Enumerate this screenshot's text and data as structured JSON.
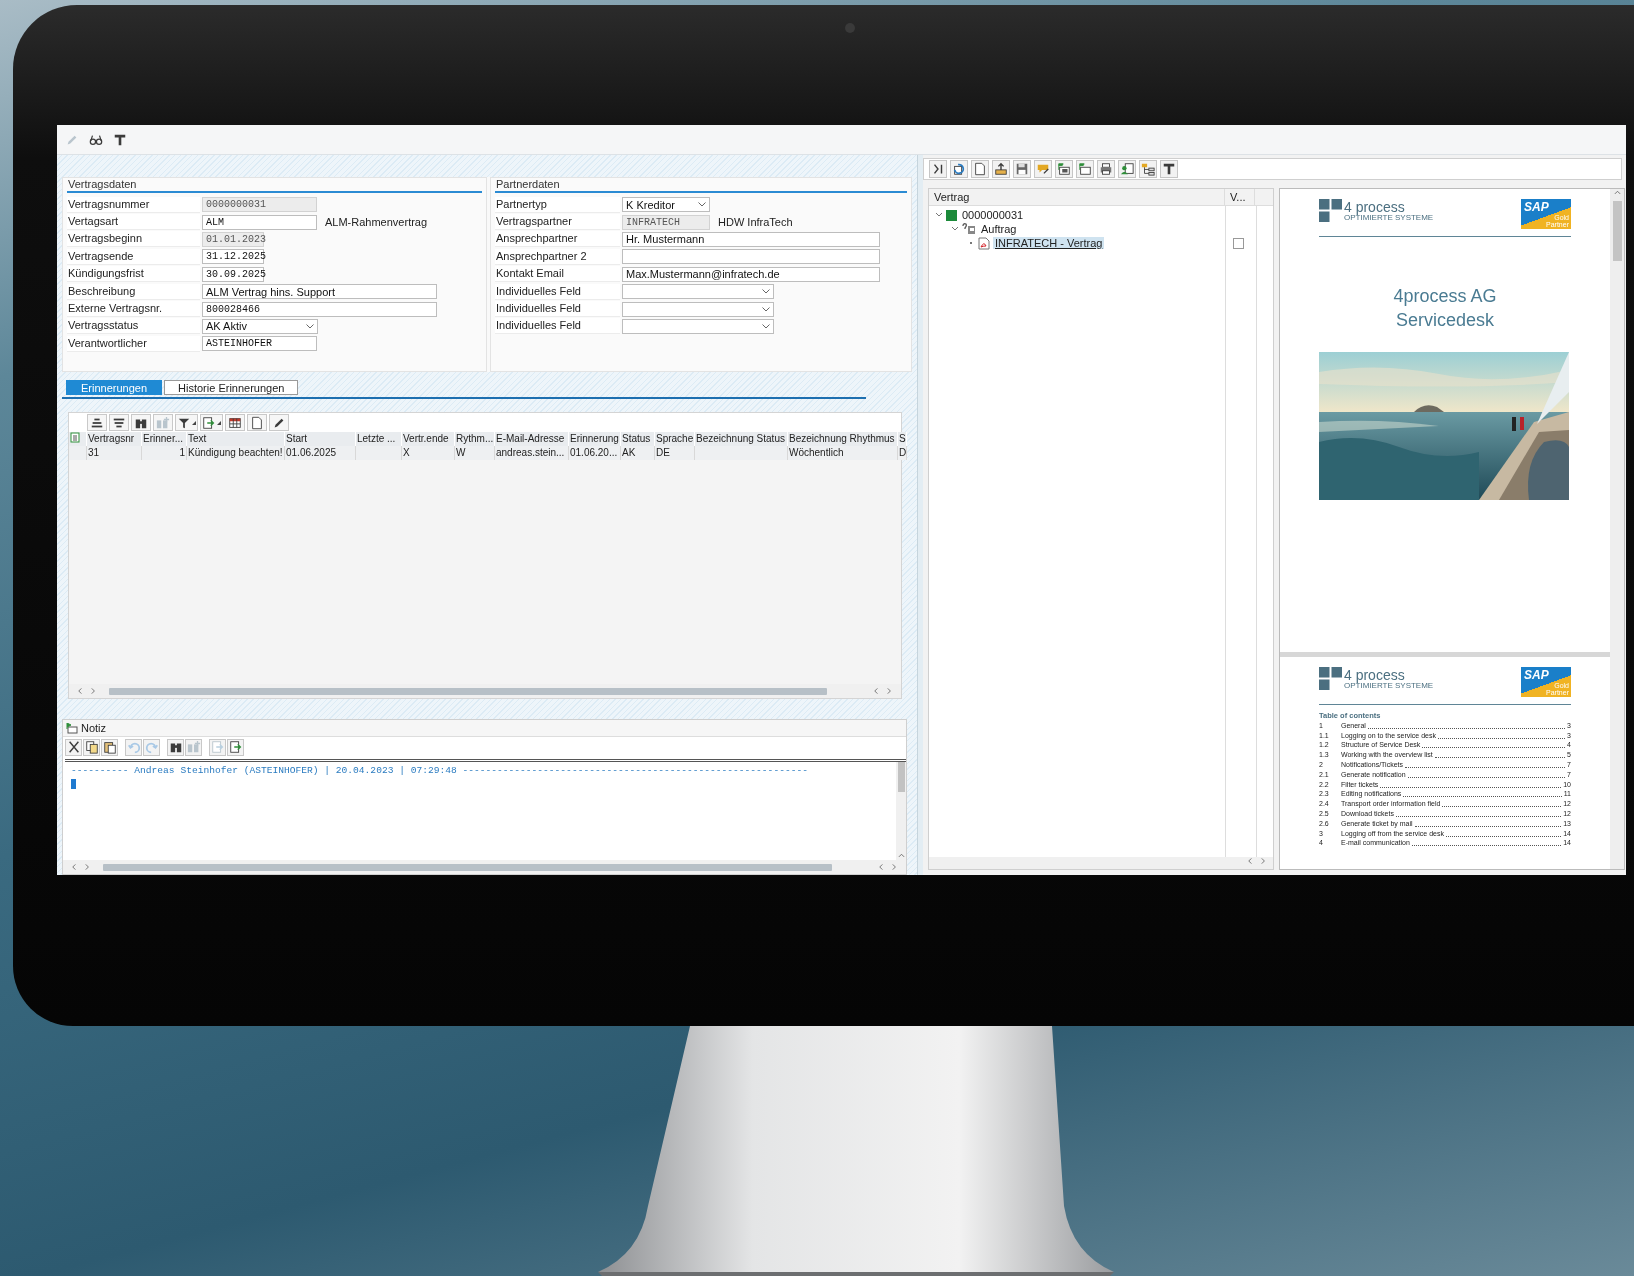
{
  "top_toolbar": [
    {
      "kind": "edit",
      "disabled": true
    },
    {
      "kind": "display",
      "disabled": false
    },
    {
      "kind": "layout",
      "disabled": false
    }
  ],
  "groups": [
    {
      "title": "Vertragsdaten",
      "fields": [
        {
          "label": "Vertragsnummer",
          "value": "0000000031",
          "kind": "code",
          "readonly": true
        },
        {
          "label": "Vertagsart",
          "value": "ALM",
          "kind": "code",
          "readonly": false,
          "note": "ALM-Rahmenvertrag"
        },
        {
          "label": "Vertragsbeginn",
          "value": "01.01.2023",
          "kind": "date",
          "readonly": true
        },
        {
          "label": "Vertragsende",
          "value": "31.12.2025",
          "kind": "date",
          "readonly": false
        },
        {
          "label": "Kündigungsfrist",
          "value": "30.09.2025",
          "kind": "date",
          "readonly": false
        },
        {
          "label": "Beschreibung",
          "value": "ALM Vertrag hins. Support",
          "kind": "long_text",
          "readonly": false
        },
        {
          "label": "Externe Vertragsnr.",
          "value": "800028466",
          "kind": "long_code",
          "readonly": false
        },
        {
          "label": "Vertragsstatus",
          "value": "AK Aktiv",
          "kind": "select",
          "readonly": false
        },
        {
          "label": "Verantwortlicher",
          "value": "ASTEINHOFER",
          "kind": "code",
          "readonly": false
        }
      ]
    },
    {
      "title": "Partnerdaten",
      "fields": [
        {
          "label": "Partnertyp",
          "value": "K Kreditor",
          "kind": "select",
          "readonly": false
        },
        {
          "label": "Vertragspartner",
          "value": "INFRATECH",
          "kind": "code",
          "readonly": true,
          "note": "HDW InfraTech"
        },
        {
          "label": "Ansprechpartner",
          "value": "Hr. Mustermann",
          "kind": "long_text",
          "readonly": false
        },
        {
          "label": "Ansprechpartner 2",
          "kind": "long_text",
          "readonly": false
        },
        {
          "label": "Kontakt Email",
          "value": "Max.Mustermann@infratech.de",
          "kind": "long_text",
          "readonly": false
        },
        {
          "label": "Individuelles Feld",
          "kind": "long_select",
          "readonly": false
        },
        {
          "label": "Individuelles Feld",
          "kind": "long_select",
          "readonly": false
        },
        {
          "label": "Individuelles Feld",
          "kind": "long_select",
          "readonly": false
        }
      ]
    }
  ],
  "tabs": [
    {
      "label": "Erinnerungen",
      "selected": true
    },
    {
      "label": "Historie Erinnerungen",
      "selected": false
    }
  ],
  "table_toolbar": [
    {
      "kind": "sort_asc",
      "disabled": false
    },
    {
      "kind": "sort_desc",
      "disabled": false
    },
    {
      "kind": "find",
      "disabled": false
    },
    {
      "kind": "find_next",
      "disabled": true
    },
    {
      "kind": "filter",
      "disabled": false
    },
    {
      "kind": "export",
      "disabled": false
    },
    {
      "kind": "grid",
      "disabled": false
    },
    {
      "kind": "new",
      "disabled": false
    },
    {
      "kind": "pencil",
      "disabled": false
    }
  ],
  "table": {
    "columns": [
      "Vertragsnr",
      "Erinner...",
      "Text",
      "Start",
      "Letzte ...",
      "Vertr.ende",
      "Rythm...",
      "E-Mail-Adresse",
      "Erinnerung",
      "Status",
      "Sprache",
      "Bezeichnung Status",
      "Bezeichnung Rhythmus",
      "S"
    ],
    "rows": [
      {
        "cells": [
          "31",
          "1",
          "Kündigung beachten!",
          "01.06.2025",
          null,
          "X",
          "W",
          "andreas.stein...",
          "01.06.20...",
          "AK",
          "DE",
          null,
          "Wöchentlich",
          "D"
        ]
      }
    ]
  },
  "note": {
    "title": "Notiz",
    "toolbar": [
      {
        "kind": "cut",
        "disabled": false
      },
      {
        "kind": "copy",
        "disabled": false
      },
      {
        "kind": "paste",
        "disabled": false
      },
      {
        "kind": "undo",
        "disabled": true
      },
      {
        "kind": "redo",
        "disabled": true
      },
      {
        "kind": "find",
        "disabled": false
      },
      {
        "kind": "find_next",
        "disabled": true
      },
      {
        "kind": "import",
        "disabled": true
      },
      {
        "kind": "export",
        "disabled": false
      }
    ],
    "text": "---------- Andreas Steinhofer (ASTEINHOFER) | 20.04.2023 | 07:29:48 ------------------------------------------------------------"
  },
  "right_toolbar": [
    {
      "kind": "collapse"
    },
    {
      "kind": "refresh"
    },
    {
      "kind": "new"
    },
    {
      "kind": "upload"
    },
    {
      "kind": "save"
    },
    {
      "kind": "comment"
    },
    {
      "kind": "tree_down"
    },
    {
      "kind": "tree_up"
    },
    {
      "kind": "print"
    },
    {
      "kind": "user"
    },
    {
      "kind": "hierarchy"
    },
    {
      "kind": "layout"
    }
  ],
  "tree": {
    "columns": [
      "Vertrag",
      "V..."
    ],
    "nodes": [
      {
        "label": "0000000031",
        "kind": "contract",
        "expanded": true,
        "selected": false,
        "children": [
          {
            "label": "Auftrag",
            "kind": "folder",
            "expanded": true,
            "selected": false,
            "children": [
              {
                "label": "INFRATECH - Vertrag",
                "kind": "pdf",
                "selected": true,
                "checked": false
              }
            ]
          }
        ]
      }
    ]
  },
  "document": {
    "pages": [
      {
        "kind": "cover",
        "logo": "4 process",
        "tagline": "OPTIMIERTE SYSTEME",
        "partner": "SAP",
        "partner_level": "Gold",
        "partner_label": "Partner",
        "title": "4process AG",
        "subtitle": "Servicedesk"
      },
      {
        "kind": "toc",
        "logo": "4 process",
        "tagline": "OPTIMIERTE SYSTEME",
        "partner": "SAP",
        "partner_level": "Gold",
        "partner_label": "Partner",
        "heading": "Table of contents",
        "entries": [
          {
            "number": "1",
            "title": "General",
            "page": "3"
          },
          {
            "number": "1.1",
            "title": "Logging on to the service desk",
            "page": "3"
          },
          {
            "number": "1.2",
            "title": "Structure of Service Desk",
            "page": "4"
          },
          {
            "number": "1.3",
            "title": "Working with the overview list",
            "page": "5"
          },
          {
            "number": "2",
            "title": "Notifications/Tickets",
            "page": "7"
          },
          {
            "number": "2.1",
            "title": "Generate notification",
            "page": "7"
          },
          {
            "number": "2.2",
            "title": "Filter tickets",
            "page": "10"
          },
          {
            "number": "2.3",
            "title": "Editing notifications",
            "page": "11"
          },
          {
            "number": "2.4",
            "title": "Transport order information field",
            "page": "12"
          },
          {
            "number": "2.5",
            "title": "Download tickets",
            "page": "12"
          },
          {
            "number": "2.6",
            "title": "Generate ticket by mail",
            "page": "13"
          },
          {
            "number": "3",
            "title": "Logging off from the service desk",
            "page": "14"
          },
          {
            "number": "4",
            "title": "E-mail communication",
            "page": "14"
          }
        ]
      }
    ]
  }
}
